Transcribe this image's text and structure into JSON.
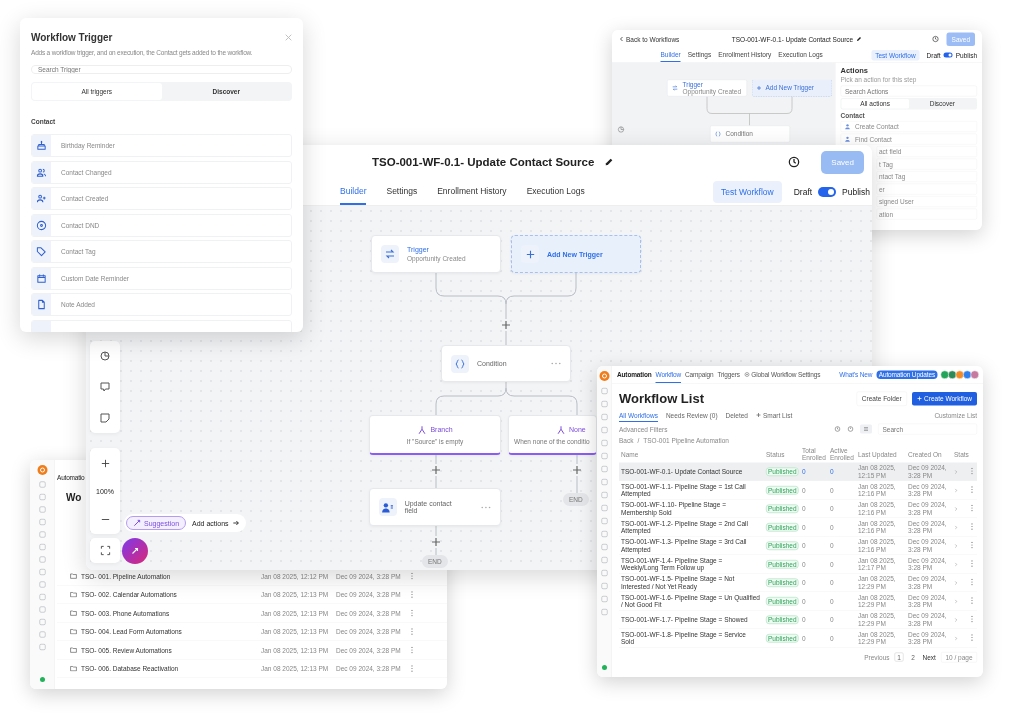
{
  "back_builder_window": {
    "back_link": "Back to Workflows",
    "title": "TSO-001-WF-0.1- Update Contact Source",
    "saved_button": {
      "label": "Saved",
      "disabled": true
    },
    "tabs": [
      {
        "label": "Builder",
        "selected": true
      },
      {
        "label": "Settings",
        "selected": false
      },
      {
        "label": "Enrollment History",
        "selected": false
      },
      {
        "label": "Execution Logs",
        "selected": false
      }
    ],
    "test_button": "Test Workflow",
    "draft_label": "Draft",
    "publish_toggle": {
      "on": true
    },
    "publish_label": "Publish",
    "trigger_node": {
      "title": "Trigger",
      "subtitle": "Opportunity Created"
    },
    "add_trigger": "Add New Trigger",
    "condition": "Condition",
    "actions_panel": {
      "title": "Actions",
      "subtitle": "Pick an action for this step",
      "search_placeholder": "Search Actions",
      "tabs": [
        {
          "label": "All actions",
          "selected": true
        },
        {
          "label": "Discover",
          "selected": false
        }
      ],
      "section": "Contact",
      "items": [
        "Create Contact",
        "Find Contact"
      ],
      "cut_items": [
        "act field",
        "t Tag",
        "ntact Tag",
        "er",
        "signed User",
        "ation"
      ]
    }
  },
  "folders_window": {
    "app": "Automatio",
    "title": "Wo",
    "rows": [
      {
        "name": "TSO- 001. Pipeline Automation",
        "last_updated": "Jan 08 2025, 12:12 PM",
        "created_on": "Dec 09 2024, 3:28 PM"
      },
      {
        "name": "TSO- 002. Calendar Automations",
        "last_updated": "Jan 08 2025, 12:13 PM",
        "created_on": "Dec 09 2024, 3:28 PM"
      },
      {
        "name": "TSO- 003. Phone Automations",
        "last_updated": "Jan 08 2025, 12:13 PM",
        "created_on": "Dec 09 2024, 3:28 PM"
      },
      {
        "name": "TSO- 004. Lead Form Automations",
        "last_updated": "Jan 08 2025, 12:13 PM",
        "created_on": "Dec 09 2024, 3:28 PM"
      },
      {
        "name": "TSO- 005. Review Automations",
        "last_updated": "Jan 08 2025, 12:13 PM",
        "created_on": "Dec 09 2024, 3:28 PM"
      },
      {
        "name": "TSO- 006. Database Reactivation",
        "last_updated": "Jan 08 2025, 12:13 PM",
        "created_on": "Dec 09 2024, 3:28 PM"
      }
    ]
  },
  "builder_window": {
    "title": "TSO-001-WF-0.1- Update Contact Source",
    "saved_button": {
      "label": "Saved",
      "disabled": true
    },
    "tabs": [
      {
        "label": "Builder",
        "selected": true
      },
      {
        "label": "Settings",
        "selected": false
      },
      {
        "label": "Enrollment History",
        "selected": false
      },
      {
        "label": "Execution Logs",
        "selected": false
      }
    ],
    "test_button": "Test Workflow",
    "draft_label": "Draft",
    "publish_toggle": {
      "on": true
    },
    "publish_label": "Publish",
    "trigger_node": {
      "title": "Trigger",
      "subtitle": "Opportunity Created"
    },
    "add_trigger": "Add New Trigger",
    "condition": "Condition",
    "branches": [
      {
        "label": "Branch",
        "description": "If \"Source\" is empty"
      },
      {
        "label": "None",
        "description": "When none of the conditio"
      }
    ],
    "action": "Update contact field",
    "end_labels": [
      "END",
      "END"
    ],
    "zoom_level": "100%",
    "suggestion": "Suggestion",
    "add_actions": "Add actions"
  },
  "trigger_panel": {
    "title": "Workflow Trigger",
    "description": "Adds a workflow trigger, and on execution, the Contact gets added to the workflow.",
    "search_placeholder": "Search Trigger",
    "tabs": [
      {
        "label": "All triggers",
        "selected": true
      },
      {
        "label": "Discover",
        "selected": false
      }
    ],
    "section": "Contact",
    "items": [
      "Birthday Reminder",
      "Contact Changed",
      "Contact Created",
      "Contact DND",
      "Contact Tag",
      "Custom Date Reminder",
      "Note Added"
    ]
  },
  "workflow_list_window": {
    "app": "Automation",
    "nav_tabs": [
      {
        "label": "Workflow",
        "selected": true
      },
      {
        "label": "Campaign",
        "selected": false
      },
      {
        "label": "Triggers",
        "selected": false
      }
    ],
    "settings_link": "Global Workflow Settings",
    "whats_new": "What's New",
    "updates_badge": "Automation Updates",
    "avatars": [
      {
        "color": "#22a55a"
      },
      {
        "color": "#2e8b57"
      },
      {
        "color": "#f28c28"
      },
      {
        "color": "#2f80ed"
      },
      {
        "color": "#c77aa0"
      }
    ],
    "title": "Workflow List",
    "create_folder": "Create Folder",
    "create_workflow": "Create Workflow",
    "list_tabs": [
      {
        "label": "All Workflows",
        "selected": true
      },
      {
        "label": "Needs Review (0)",
        "selected": false
      },
      {
        "label": "Deleted",
        "selected": false
      }
    ],
    "smart_list": "Smart List",
    "customize": "Customize List",
    "filters": "Advanced Filters",
    "search_placeholder": "Search",
    "breadcrumb": [
      "Back",
      "TSO-001 Pipeline Automation"
    ],
    "breadcrumb_separator": "/",
    "columns": [
      "Name",
      "Status",
      "Total Enrolled",
      "Active Enrolled",
      "Last Updated",
      "Created On",
      "Stats"
    ],
    "rows": [
      {
        "name": "TSO-001-WF-0.1- Update Contact Source",
        "status": "Published",
        "total": "0",
        "active": "0",
        "last_updated": "Jan 08 2025, 12:15 PM",
        "created_on": "Dec 09 2024, 3:28 PM",
        "selected": true
      },
      {
        "name": "TSO-001-WF-1.1- Pipeline Stage = 1st Call Attempted",
        "status": "Published",
        "total": "0",
        "active": "0",
        "last_updated": "Jan 08 2025, 12:16 PM",
        "created_on": "Dec 09 2024, 3:28 PM",
        "selected": false
      },
      {
        "name": "TSO-001-WF-1.10- Pipeline Stage = Membership Sold",
        "status": "Published",
        "total": "0",
        "active": "0",
        "last_updated": "Jan 08 2025, 12:16 PM",
        "created_on": "Dec 09 2024, 3:28 PM",
        "selected": false
      },
      {
        "name": "TSO-001-WF-1.2- Pipeline Stage = 2nd Call Attempted",
        "status": "Published",
        "total": "0",
        "active": "0",
        "last_updated": "Jan 08 2025, 12:16 PM",
        "created_on": "Dec 09 2024, 3:28 PM",
        "selected": false
      },
      {
        "name": "TSO-001-WF-1.3- Pipeline Stage = 3rd Call Attempted",
        "status": "Published",
        "total": "0",
        "active": "0",
        "last_updated": "Jan 08 2025, 12:16 PM",
        "created_on": "Dec 09 2024, 3:28 PM",
        "selected": false
      },
      {
        "name": "TSO-001-WF-1.4- Pipeline Stage = Weekly/Long Term Follow up",
        "status": "Published",
        "total": "0",
        "active": "0",
        "last_updated": "Jan 08 2025, 12:17 PM",
        "created_on": "Dec 09 2024, 3:28 PM",
        "selected": false
      },
      {
        "name": "TSO-001-WF-1.5- Pipeline Stage = Not Interested / Not Yet Ready",
        "status": "Published",
        "total": "0",
        "active": "0",
        "last_updated": "Jan 08 2025, 12:29 PM",
        "created_on": "Dec 09 2024, 3:28 PM",
        "selected": false
      },
      {
        "name": "TSO-001-WF-1.6- Pipeline Stage = Un Qualified / Not Good Fit",
        "status": "Published",
        "total": "0",
        "active": "0",
        "last_updated": "Jan 08 2025, 12:29 PM",
        "created_on": "Dec 09 2024, 3:28 PM",
        "selected": false
      },
      {
        "name": "TSO-001-WF-1.7- Pipeline Stage = Showed",
        "status": "Published",
        "total": "0",
        "active": "0",
        "last_updated": "Jan 08 2025, 12:29 PM",
        "created_on": "Dec 09 2024, 3:28 PM",
        "selected": false
      },
      {
        "name": "TSO-001-WF-1.8- Pipeline Stage = Service Sold",
        "status": "Published",
        "total": "0",
        "active": "0",
        "last_updated": "Jan 08 2025, 12:29 PM",
        "created_on": "Dec 09 2024, 3:28 PM",
        "selected": false
      }
    ],
    "pagination": {
      "previous": "Previous",
      "pages": [
        {
          "label": "1",
          "selected": true
        },
        {
          "label": "2",
          "selected": false
        }
      ],
      "next": "Next",
      "page_size": "10 / page"
    }
  }
}
